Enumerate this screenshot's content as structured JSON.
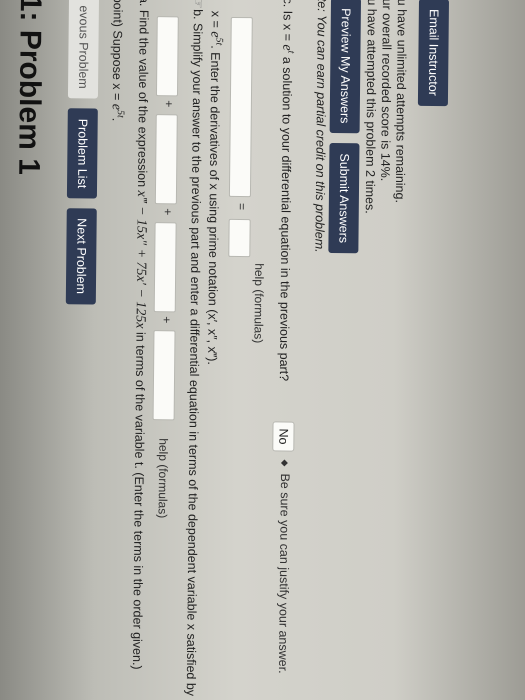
{
  "page": {
    "title": "1: Problem 1",
    "nav": {
      "previous": "evous Problem",
      "list": "Problem List",
      "next": "Next Problem"
    },
    "intro": {
      "prefix": "point) Suppose x = ",
      "expr": "e",
      "sup": "5t",
      "suffix": "."
    },
    "part_a": {
      "prefix": "a. Find the value of the expression ",
      "expr": "x‴ − 15x″ + 75x′ − 125x",
      "suffix": " in terms of the variable t. (Enter the terms in the order given.)",
      "plus": "+",
      "help": "help (formulas)"
    },
    "part_b": {
      "line1": "b. Simplify your answer to the previous part and enter a differential equation in terms of the dependent variable x satisfied by",
      "line2_prefix": "x = ",
      "line2_expr": "e",
      "line2_sup": "5t",
      "line2_suffix": ". Enter the derivatives of x using prime notation (x′, x″, x‴).",
      "equals": "=",
      "help": "help (formulas)"
    },
    "part_c": {
      "prefix": "c. Is x = ",
      "expr": "e",
      "sup": "t",
      "suffix": " a solution to your differential equation in the previous part?",
      "select_value": "No",
      "after": "Be sure you can justify your answer."
    },
    "note": "te: You can earn partial credit on this problem.",
    "buttons": {
      "preview": "Preview My Answers",
      "submit": "Submit Answers"
    },
    "status": {
      "attempted": "u have attempted this problem 2 times.",
      "score": "ur overall recorded score is 14%.",
      "remaining": "u have unlimited attempts remaining."
    },
    "email": "Email Instructor"
  }
}
